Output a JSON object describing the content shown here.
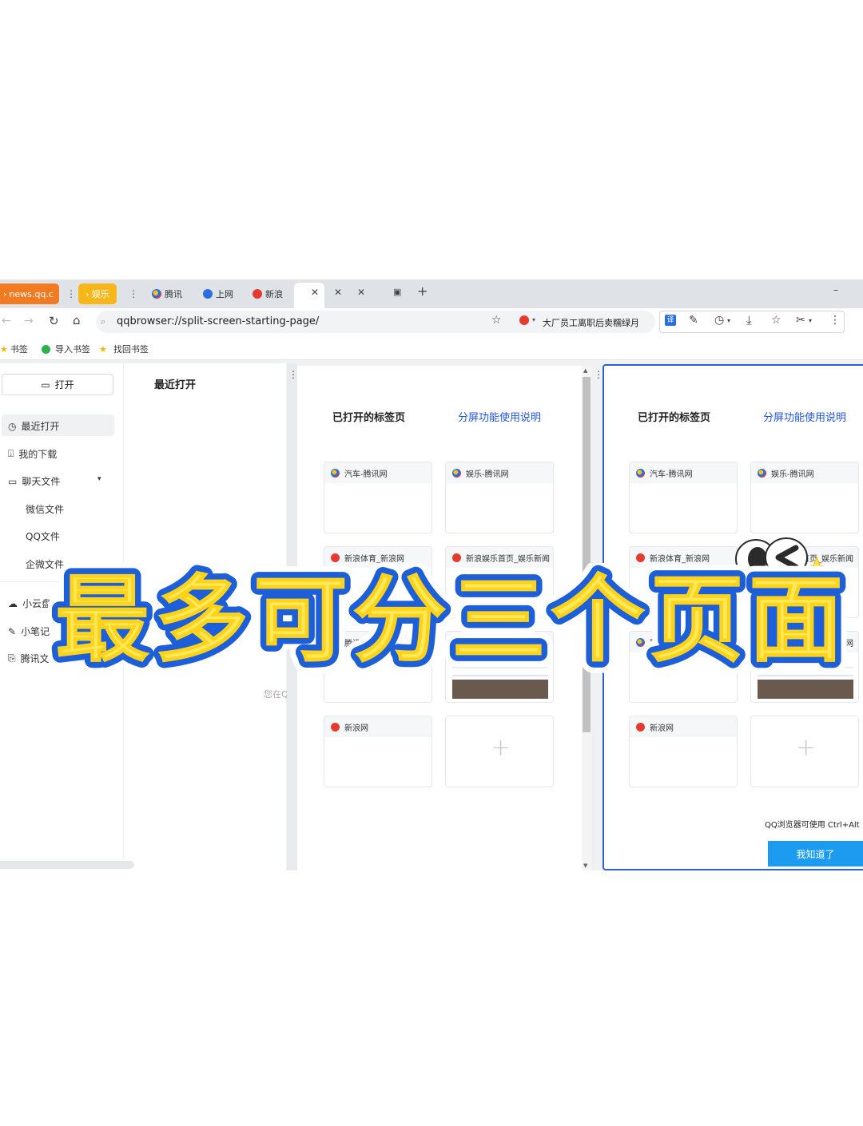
{
  "tabs": {
    "news": "news.qq.c",
    "ent": "娱乐",
    "t1": "腾讯",
    "t2": "上网",
    "t3": "新浪"
  },
  "toolbar": {
    "url": "qqbrowser://split-screen-starting-page/",
    "search_hint": "大厂员工离职后卖糯绿月"
  },
  "bookmarks": {
    "b1": "书签",
    "b2": "导入书签",
    "b3": "找回书签"
  },
  "sidebar": {
    "open": "打开",
    "recent": "最近打开",
    "downloads": "我的下载",
    "chat": "聊天文件",
    "wechat": "微信文件",
    "qq": "QQ文件",
    "wecom": "企微文件",
    "cloud": "小云盘",
    "notes": "小笔记",
    "docs": "腾讯文档"
  },
  "pane1": {
    "title": "最近打开",
    "faded": "您在Q"
  },
  "pane2": {
    "heading": "已打开的标签页",
    "help": "分屏功能使用说明",
    "cards": [
      "汽车-腾讯网",
      "娱乐-腾讯网",
      "新浪体育_新浪网",
      "新浪娱乐首页_娱乐新闻",
      "腾讯网",
      "",
      "新浪网"
    ]
  },
  "pane3": {
    "heading": "已打开的标签页",
    "help": "分屏功能使用说明",
    "cards": [
      "汽车-腾讯网",
      "娱乐-腾讯网",
      "新浪体育_新浪网",
      "首页_娱乐新闻",
      "腾讯网",
      "网",
      "新浪网"
    ],
    "hint": "QQ浏览器可使用 Ctrl+Alt",
    "ok": "我知道了"
  },
  "overlay": {
    "title": "最多可分三个页面"
  },
  "colors": {
    "tab_news": "#f27a21",
    "tab_ent": "#f7b719",
    "accent": "#2356d6",
    "ok_button": "#1c9cf1",
    "title_fill": "#ffe95a",
    "title_stroke": "#1d5fd8"
  }
}
